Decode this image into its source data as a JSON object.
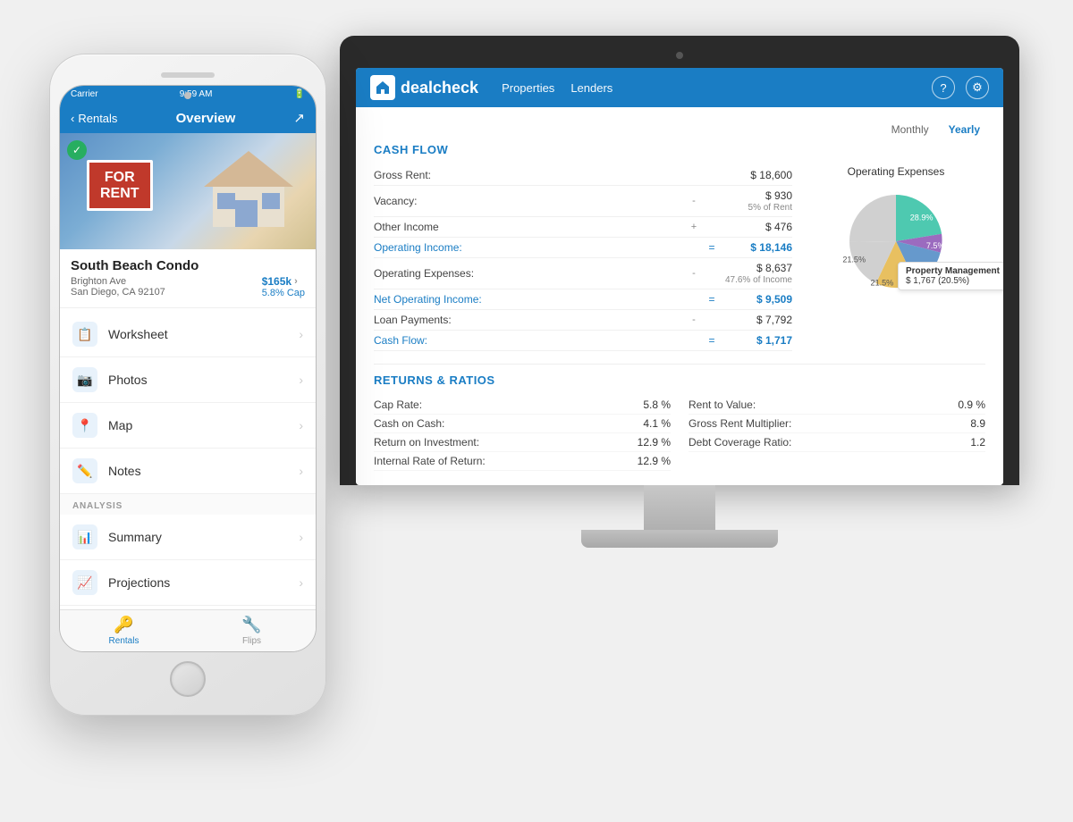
{
  "app": {
    "name": "dealcheck",
    "logo_icon": "🏠"
  },
  "desktop": {
    "nav": {
      "links": [
        "Properties",
        "Lenders"
      ],
      "help_label": "?",
      "settings_label": "⚙"
    },
    "toggle": {
      "monthly_label": "Monthly",
      "yearly_label": "Yearly",
      "active": "Yearly"
    },
    "cash_flow": {
      "title": "CASH FLOW",
      "rows": [
        {
          "label": "Gross Rent:",
          "op": "",
          "eq": "",
          "value": "$ 18,600",
          "sub": "",
          "highlight": false
        },
        {
          "label": "Vacancy:",
          "op": "-",
          "eq": "",
          "value": "$ 930",
          "sub": "5% of Rent",
          "highlight": false
        },
        {
          "label": "Other Income",
          "op": "+",
          "eq": "",
          "value": "$ 476",
          "sub": "",
          "highlight": false
        },
        {
          "label": "Operating Income:",
          "op": "",
          "eq": "=",
          "value": "$ 18,146",
          "sub": "",
          "highlight": true
        },
        {
          "label": "Operating Expenses:",
          "op": "-",
          "eq": "",
          "value": "$ 8,637",
          "sub": "47.6% of Income",
          "highlight": false
        },
        {
          "label": "Net Operating Income:",
          "op": "",
          "eq": "=",
          "value": "$ 9,509",
          "sub": "",
          "highlight": true
        },
        {
          "label": "Loan Payments:",
          "op": "-",
          "eq": "",
          "value": "$ 7,792",
          "sub": "",
          "highlight": false
        },
        {
          "label": "Cash Flow:",
          "op": "",
          "eq": "=",
          "value": "$ 1,717",
          "sub": "",
          "highlight": true
        }
      ]
    },
    "pie_chart": {
      "title": "Operating Expenses",
      "segments": [
        {
          "label": "28.9%",
          "color": "#4ec9b0",
          "percent": 28.9,
          "start": 0
        },
        {
          "label": "7.5%",
          "color": "#9b6bbf",
          "percent": 7.5
        },
        {
          "label": "20.5%",
          "color": "#6699cc",
          "percent": 20.5
        },
        {
          "label": "21.5%",
          "color": "#e8c060",
          "percent": 21.5
        },
        {
          "label": "21.5%",
          "color": "#f0f0f0",
          "percent": 21.5
        }
      ],
      "tooltip_label": "Property Management",
      "tooltip_value": "$ 1,767 (20.5%)"
    },
    "returns": {
      "title": "RETURNS & RATIOS",
      "left_rows": [
        {
          "label": "Cap Rate:",
          "value": "5.8 %"
        },
        {
          "label": "Cash on Cash:",
          "value": "4.1 %"
        },
        {
          "label": "Return on Investment:",
          "value": "12.9 %"
        },
        {
          "label": "Internal Rate of Return:",
          "value": "12.9 %"
        }
      ],
      "right_rows": [
        {
          "label": "Rent to Value:",
          "value": "0.9 %"
        },
        {
          "label": "Gross Rent Multiplier:",
          "value": "8.9"
        },
        {
          "label": "Debt Coverage Ratio:",
          "value": "1.2"
        }
      ]
    }
  },
  "phone": {
    "status_bar": {
      "carrier": "Carrier",
      "time": "9:59 AM",
      "battery": "████"
    },
    "nav": {
      "back_label": "Rentals",
      "title": "Overview",
      "share_icon": "↗"
    },
    "property": {
      "verified": "✓",
      "for_rent_line1": "FOR",
      "for_rent_line2": "RENT",
      "name": "South Beach Condo",
      "street": "Brighton Ave",
      "city": "San Diego, CA 92107",
      "price": "$165k",
      "cap": "5.8% Cap"
    },
    "menu_items": [
      {
        "icon": "📋",
        "label": "Worksheet",
        "id": "worksheet"
      },
      {
        "icon": "📷",
        "label": "Photos",
        "id": "photos"
      },
      {
        "icon": "📍",
        "label": "Map",
        "id": "map"
      },
      {
        "icon": "✏️",
        "label": "Notes",
        "id": "notes"
      }
    ],
    "analysis_section_label": "ANALYSIS",
    "analysis_items": [
      {
        "icon": "📊",
        "label": "Summary",
        "id": "summary"
      },
      {
        "icon": "📈",
        "label": "Projections",
        "id": "projections"
      }
    ],
    "tabs": [
      {
        "label": "Rentals",
        "icon": "🔑",
        "active": true
      },
      {
        "label": "Flips",
        "icon": "🔧",
        "active": false
      }
    ]
  }
}
